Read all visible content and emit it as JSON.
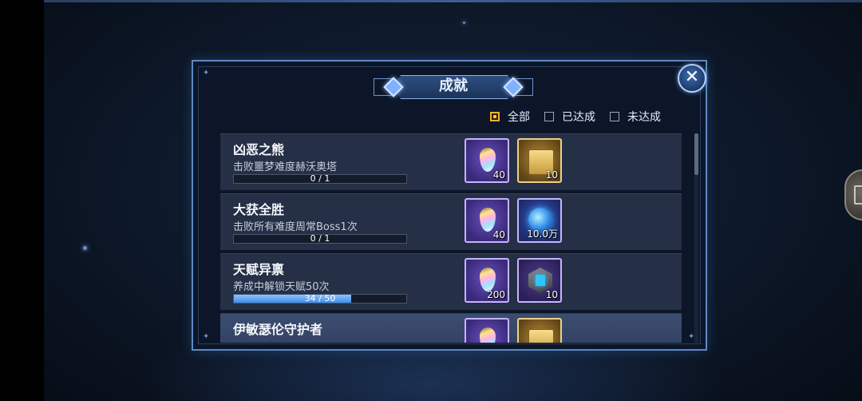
{
  "dialog": {
    "title": "成就",
    "close_symbol": "✕"
  },
  "filters": [
    {
      "label": "全部",
      "checked": true
    },
    {
      "label": "已达成",
      "checked": false
    },
    {
      "label": "未达成",
      "checked": false
    }
  ],
  "achievements": [
    {
      "name": "凶恶之熊",
      "desc": "击败噩梦难度赫沃奥塔",
      "progress_text": "0 / 1",
      "progress": 0.0,
      "rewards": [
        {
          "icon": "prism-drop-icon",
          "qty": "40"
        },
        {
          "icon": "gold-scroll-icon",
          "qty": "10"
        }
      ]
    },
    {
      "name": "大获全胜",
      "desc": "击败所有难度周常Boss1次",
      "progress_text": "0 / 1",
      "progress": 0.0,
      "rewards": [
        {
          "icon": "prism-drop-icon",
          "qty": "40"
        },
        {
          "icon": "blue-orb-icon",
          "qty": "10.0万"
        }
      ]
    },
    {
      "name": "天赋异禀",
      "desc": "养成中解锁天赋50次",
      "progress_text": "34 / 50",
      "progress": 0.68,
      "rewards": [
        {
          "icon": "prism-drop-icon",
          "qty": "200"
        },
        {
          "icon": "rune-stone-icon",
          "qty": "10"
        }
      ]
    },
    {
      "name": "伊敏瑟伦守护者",
      "desc": "",
      "progress_text": "",
      "progress": 0.0,
      "rewards": [
        {
          "icon": "prism-drop-icon",
          "qty": ""
        },
        {
          "icon": "gold-scroll-icon",
          "qty": ""
        }
      ]
    }
  ],
  "colors": {
    "accent": "#5c89c4",
    "checked": "#f2b233",
    "progress_fill": "#3f8ee8"
  }
}
